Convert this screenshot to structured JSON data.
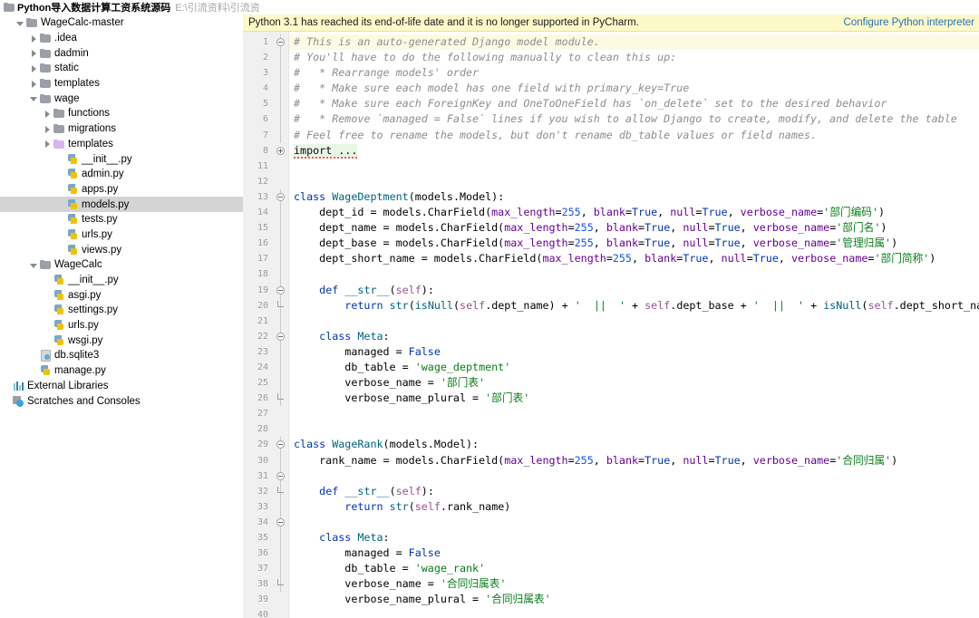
{
  "titlebar": {
    "folder_icon": "folder-icon",
    "project_name": "Python导入数据计算工资系统源码",
    "project_path": "E:\\引流资料\\引流资"
  },
  "tree": {
    "items": [
      {
        "label": "WageCalc-master",
        "indent": 1,
        "kind": "folder",
        "arrow": "open",
        "selected": false
      },
      {
        "label": ".idea",
        "indent": 2,
        "kind": "folder",
        "arrow": "closed",
        "selected": false
      },
      {
        "label": "dadmin",
        "indent": 2,
        "kind": "folder",
        "arrow": "closed",
        "selected": false
      },
      {
        "label": "static",
        "indent": 2,
        "kind": "folder",
        "arrow": "closed",
        "selected": false
      },
      {
        "label": "templates",
        "indent": 2,
        "kind": "folder",
        "arrow": "closed",
        "selected": false
      },
      {
        "label": "wage",
        "indent": 2,
        "kind": "folder",
        "arrow": "open",
        "selected": false
      },
      {
        "label": "functions",
        "indent": 3,
        "kind": "folder",
        "arrow": "closed",
        "selected": false
      },
      {
        "label": "migrations",
        "indent": 3,
        "kind": "folder",
        "arrow": "closed",
        "selected": false
      },
      {
        "label": "templates",
        "indent": 3,
        "kind": "folder-purple",
        "arrow": "closed",
        "selected": false
      },
      {
        "label": "__init__.py",
        "indent": 4,
        "kind": "python",
        "arrow": "none",
        "selected": false
      },
      {
        "label": "admin.py",
        "indent": 4,
        "kind": "python",
        "arrow": "none",
        "selected": false
      },
      {
        "label": "apps.py",
        "indent": 4,
        "kind": "python",
        "arrow": "none",
        "selected": false
      },
      {
        "label": "models.py",
        "indent": 4,
        "kind": "python",
        "arrow": "none",
        "selected": true
      },
      {
        "label": "tests.py",
        "indent": 4,
        "kind": "python",
        "arrow": "none",
        "selected": false
      },
      {
        "label": "urls.py",
        "indent": 4,
        "kind": "python",
        "arrow": "none",
        "selected": false
      },
      {
        "label": "views.py",
        "indent": 4,
        "kind": "python",
        "arrow": "none",
        "selected": false
      },
      {
        "label": "WageCalc",
        "indent": 2,
        "kind": "folder",
        "arrow": "open",
        "selected": false
      },
      {
        "label": "__init__.py",
        "indent": 3,
        "kind": "python",
        "arrow": "none",
        "selected": false
      },
      {
        "label": "asgi.py",
        "indent": 3,
        "kind": "python",
        "arrow": "none",
        "selected": false
      },
      {
        "label": "settings.py",
        "indent": 3,
        "kind": "python",
        "arrow": "none",
        "selected": false
      },
      {
        "label": "urls.py",
        "indent": 3,
        "kind": "python",
        "arrow": "none",
        "selected": false
      },
      {
        "label": "wsgi.py",
        "indent": 3,
        "kind": "python",
        "arrow": "none",
        "selected": false
      },
      {
        "label": "db.sqlite3",
        "indent": 2,
        "kind": "db",
        "arrow": "none",
        "selected": false
      },
      {
        "label": "manage.py",
        "indent": 2,
        "kind": "python",
        "arrow": "none",
        "selected": false
      },
      {
        "label": "External Libraries",
        "indent": 0,
        "kind": "library",
        "arrow": "none",
        "selected": false
      },
      {
        "label": "Scratches and Consoles",
        "indent": 0,
        "kind": "scratches",
        "arrow": "none",
        "selected": false
      }
    ]
  },
  "notification": {
    "message": "Python 3.1 has reached its end-of-life date and it is no longer supported in PyCharm.",
    "link_label": "Configure Python interpreter",
    "background": "#fcf9c9",
    "link_color": "#2a6fb5"
  },
  "editor": {
    "file": "models.py",
    "line_numbers": [
      1,
      2,
      3,
      4,
      5,
      6,
      7,
      8,
      11,
      12,
      13,
      14,
      15,
      16,
      17,
      18,
      19,
      20,
      21,
      22,
      23,
      24,
      25,
      26,
      27,
      28,
      29,
      30,
      31,
      32,
      33,
      34,
      35,
      36,
      37,
      38,
      39,
      40
    ],
    "code_lines": [
      "# This is an auto-generated Django model module.",
      "# You'll have to do the following manually to clean this up:",
      "#   * Rearrange models' order",
      "#   * Make sure each model has one field with primary_key=True",
      "#   * Make sure each ForeignKey and OneToOneField has `on_delete` set to the desired behavior",
      "#   * Remove `managed = False` lines if you wish to allow Django to create, modify, and delete the table",
      "# Feel free to rename the models, but don't rename db_table values or field names.",
      "import ...",
      "",
      "",
      "class WageDeptment(models.Model):",
      "    dept_id = models.CharField(max_length=255, blank=True, null=True, verbose_name='部门编码')",
      "    dept_name = models.CharField(max_length=255, blank=True, null=True, verbose_name='部门名')",
      "    dept_base = models.CharField(max_length=255, blank=True, null=True, verbose_name='管理归属')",
      "    dept_short_name = models.CharField(max_length=255, blank=True, null=True, verbose_name='部门简称')",
      "",
      "    def __str__(self):",
      "        return str(isNull(self.dept_name) + '  ||  ' + self.dept_base + '  ||  ' + isNull(self.dept_short_name))",
      "",
      "    class Meta:",
      "        managed = False",
      "        db_table = 'wage_deptment'",
      "        verbose_name = '部门表'",
      "        verbose_name_plural = '部门表'",
      "",
      "",
      "class WageRank(models.Model):",
      "    rank_name = models.CharField(max_length=255, blank=True, null=True, verbose_name='合同归属')",
      "",
      "    def __str__(self):",
      "        return str(self.rank_name)",
      "",
      "    class Meta:",
      "        managed = False",
      "        db_table = 'wage_rank'",
      "        verbose_name = '合同归属表'",
      "        verbose_name_plural = '合同归属表'",
      ""
    ],
    "colors": {
      "comment": "#8d8d8d",
      "keyword": "#0033b3",
      "string": "#067d17",
      "number": "#1750eb",
      "kwarg": "#660099",
      "self": "#94558d",
      "function": "#00627a",
      "gutter_bg": "#f0f0f0",
      "highlight_line": "#fdfae4",
      "folded_bg": "#e9f5e6"
    }
  }
}
